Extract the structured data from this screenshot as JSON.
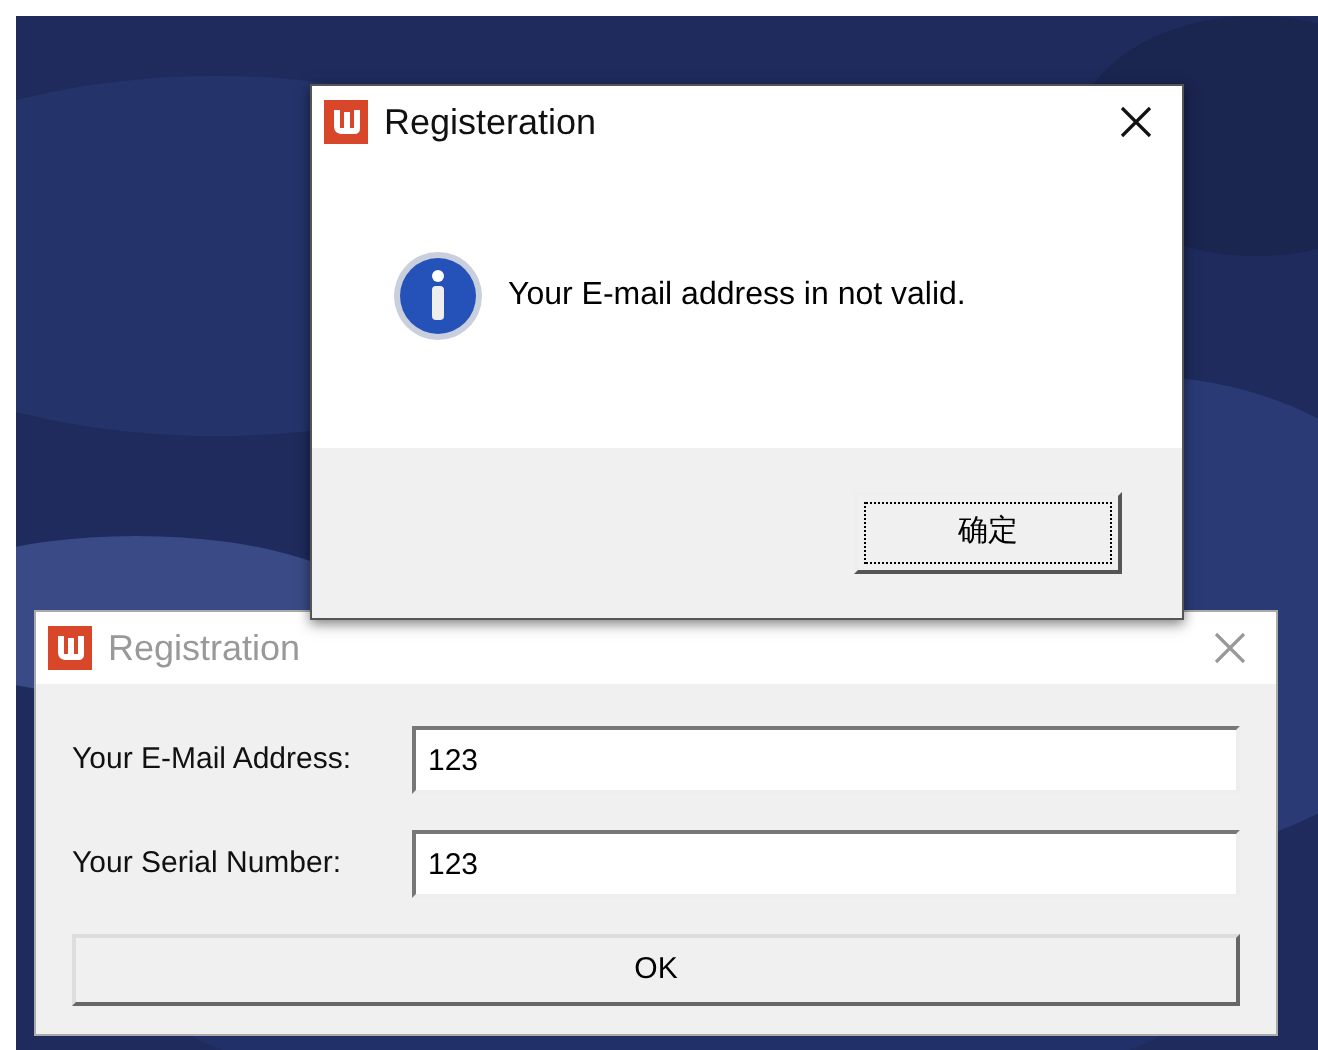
{
  "main_window": {
    "title": "Registration",
    "active": false,
    "fields": [
      {
        "label": "Your E-Mail Address:",
        "value": "123"
      },
      {
        "label": "Your Serial Number:",
        "value": "123"
      }
    ],
    "button": "OK"
  },
  "dialog": {
    "title": "Registeration",
    "active": true,
    "message": "Your E-mail address in not valid.",
    "button": "确定"
  }
}
